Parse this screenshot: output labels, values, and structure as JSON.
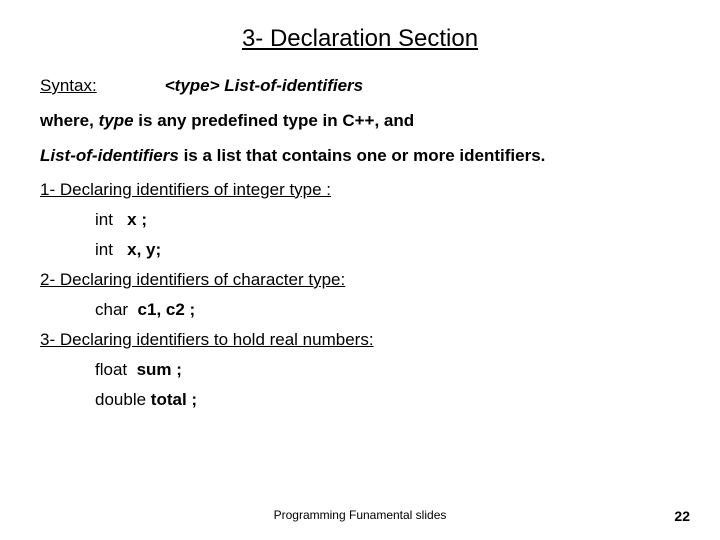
{
  "title": "3- Declaration Section",
  "syntax": {
    "label": "Syntax:",
    "value": "<type>  List-of-identifiers"
  },
  "where": {
    "prefix": "where, ",
    "type_word": "type",
    "rest": " is any predefined type in C++, and"
  },
  "list": {
    "term": "List-of-identifiers",
    "rest": " is a list that contains one or more identifiers."
  },
  "sections": [
    {
      "heading": "1- Declaring identifiers of integer type :",
      "examples": [
        {
          "kw": "int",
          "rest": "x ;"
        },
        {
          "kw": "int",
          "rest": "x, y;"
        }
      ]
    },
    {
      "heading": "2- Declaring identifiers of character type:",
      "examples": [
        {
          "kw": "char",
          "rest": "c1, c2 ;"
        }
      ]
    },
    {
      "heading": "3- Declaring identifiers to hold real numbers:",
      "examples": [
        {
          "kw": "float",
          "rest": "sum ;"
        },
        {
          "kw": "double ",
          "rest": "total ;"
        }
      ]
    }
  ],
  "footer": "Programming Funamental slides",
  "page": "22"
}
